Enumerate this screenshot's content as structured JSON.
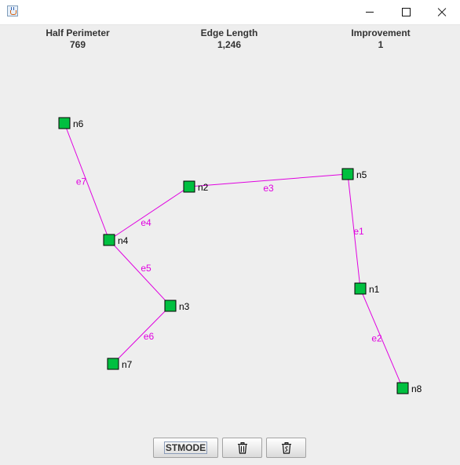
{
  "window": {
    "icon": "java-cup-icon",
    "controls": [
      "minimize-icon",
      "maximize-icon",
      "close-icon"
    ]
  },
  "stats": {
    "half_perimeter": {
      "label": "Half Perimeter",
      "value": "769"
    },
    "edge_length": {
      "label": "Edge Length",
      "value": "1,246"
    },
    "improvement": {
      "label": "Improvement",
      "value": "1"
    }
  },
  "graph": {
    "node_color": "#00c040",
    "edge_color": "#e000e0",
    "nodes": [
      {
        "id": "n1",
        "label": "n1"
      },
      {
        "id": "n2",
        "label": "n2"
      },
      {
        "id": "n3",
        "label": "n3"
      },
      {
        "id": "n4",
        "label": "n4"
      },
      {
        "id": "n5",
        "label": "n5"
      },
      {
        "id": "n6",
        "label": "n6"
      },
      {
        "id": "n7",
        "label": "n7"
      },
      {
        "id": "n8",
        "label": "n8"
      }
    ],
    "edges": [
      {
        "id": "e1",
        "label": "e1",
        "from": "n5",
        "to": "n1"
      },
      {
        "id": "e2",
        "label": "e2",
        "from": "n1",
        "to": "n8"
      },
      {
        "id": "e3",
        "label": "e3",
        "from": "n2",
        "to": "n5"
      },
      {
        "id": "e4",
        "label": "e4",
        "from": "n4",
        "to": "n2"
      },
      {
        "id": "e5",
        "label": "e5",
        "from": "n4",
        "to": "n3"
      },
      {
        "id": "e6",
        "label": "e6",
        "from": "n3",
        "to": "n7"
      },
      {
        "id": "e7",
        "label": "e7",
        "from": "n6",
        "to": "n4"
      }
    ]
  },
  "toolbar": {
    "stmode_label": "STMODE",
    "delete_icon": "trash-icon",
    "delete_selected_icon": "trash-selected-icon"
  }
}
